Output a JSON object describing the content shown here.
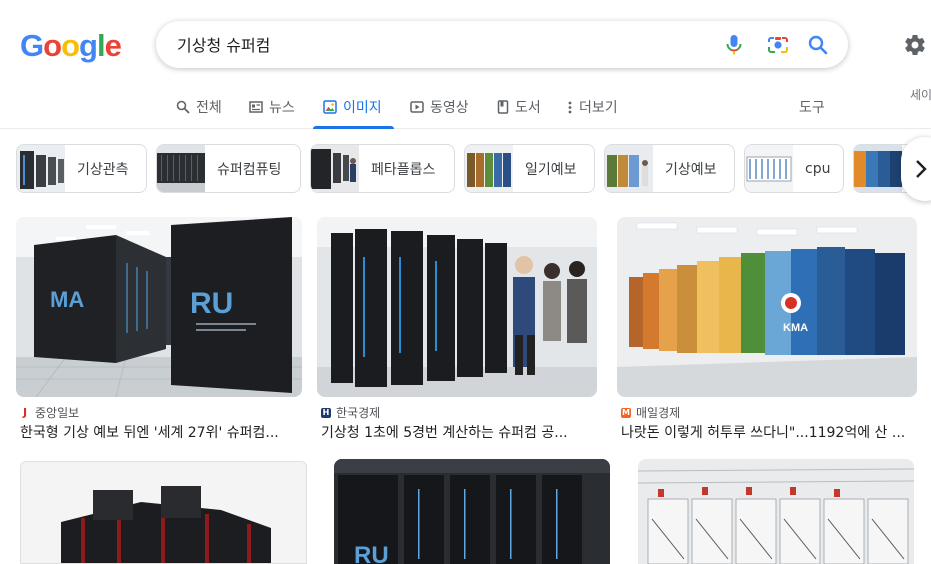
{
  "logo": "Google",
  "search": {
    "query": "기상청 슈퍼컴"
  },
  "icons": {
    "mic": "mic-icon",
    "lens": "camera-lens-icon",
    "search": "search-icon",
    "settings": "gear-icon"
  },
  "tabs": [
    {
      "label": "전체",
      "icon": "search-icon"
    },
    {
      "label": "뉴스",
      "icon": "news-icon"
    },
    {
      "label": "이미지",
      "icon": "image-icon",
      "active": true
    },
    {
      "label": "동영상",
      "icon": "play-icon"
    },
    {
      "label": "도서",
      "icon": "book-icon"
    },
    {
      "label": "더보기",
      "icon": "more-dots-icon"
    }
  ],
  "tools_label": "도구",
  "safe_search_label": "세이",
  "chips": [
    {
      "label": "기상관측"
    },
    {
      "label": "슈퍼컴퓨팅"
    },
    {
      "label": "페타플롭스"
    },
    {
      "label": "일기예보"
    },
    {
      "label": "기상예보"
    },
    {
      "label": "cpu"
    },
    {
      "label": ""
    }
  ],
  "results": [
    {
      "source": "중앙일보",
      "favicon": "J",
      "favicon_color": "#d93025",
      "title": "한국형 기상 예보 뒤엔 '세계 27위' 슈퍼컴...",
      "img_text": [
        "MA",
        "RU"
      ]
    },
    {
      "source": "한국경제",
      "favicon": "H",
      "favicon_color": "#1f3a6e",
      "title": "기상청 1초에 5경번 계산하는 슈퍼컴 공..."
    },
    {
      "source": "매일경제",
      "favicon": "M",
      "favicon_color": "#f26522",
      "title": "나랏돈 이렇게 허투루 쓰다니\"...1192억에 산 ...",
      "img_text": [
        "KMA"
      ]
    },
    {
      "source": "",
      "title": ""
    },
    {
      "source": "",
      "title": "",
      "img_text": [
        "RU"
      ]
    },
    {
      "source": "",
      "title": ""
    }
  ],
  "colors": {
    "accent": "#1a73e8",
    "text": "#202124",
    "muted": "#5f6368"
  }
}
